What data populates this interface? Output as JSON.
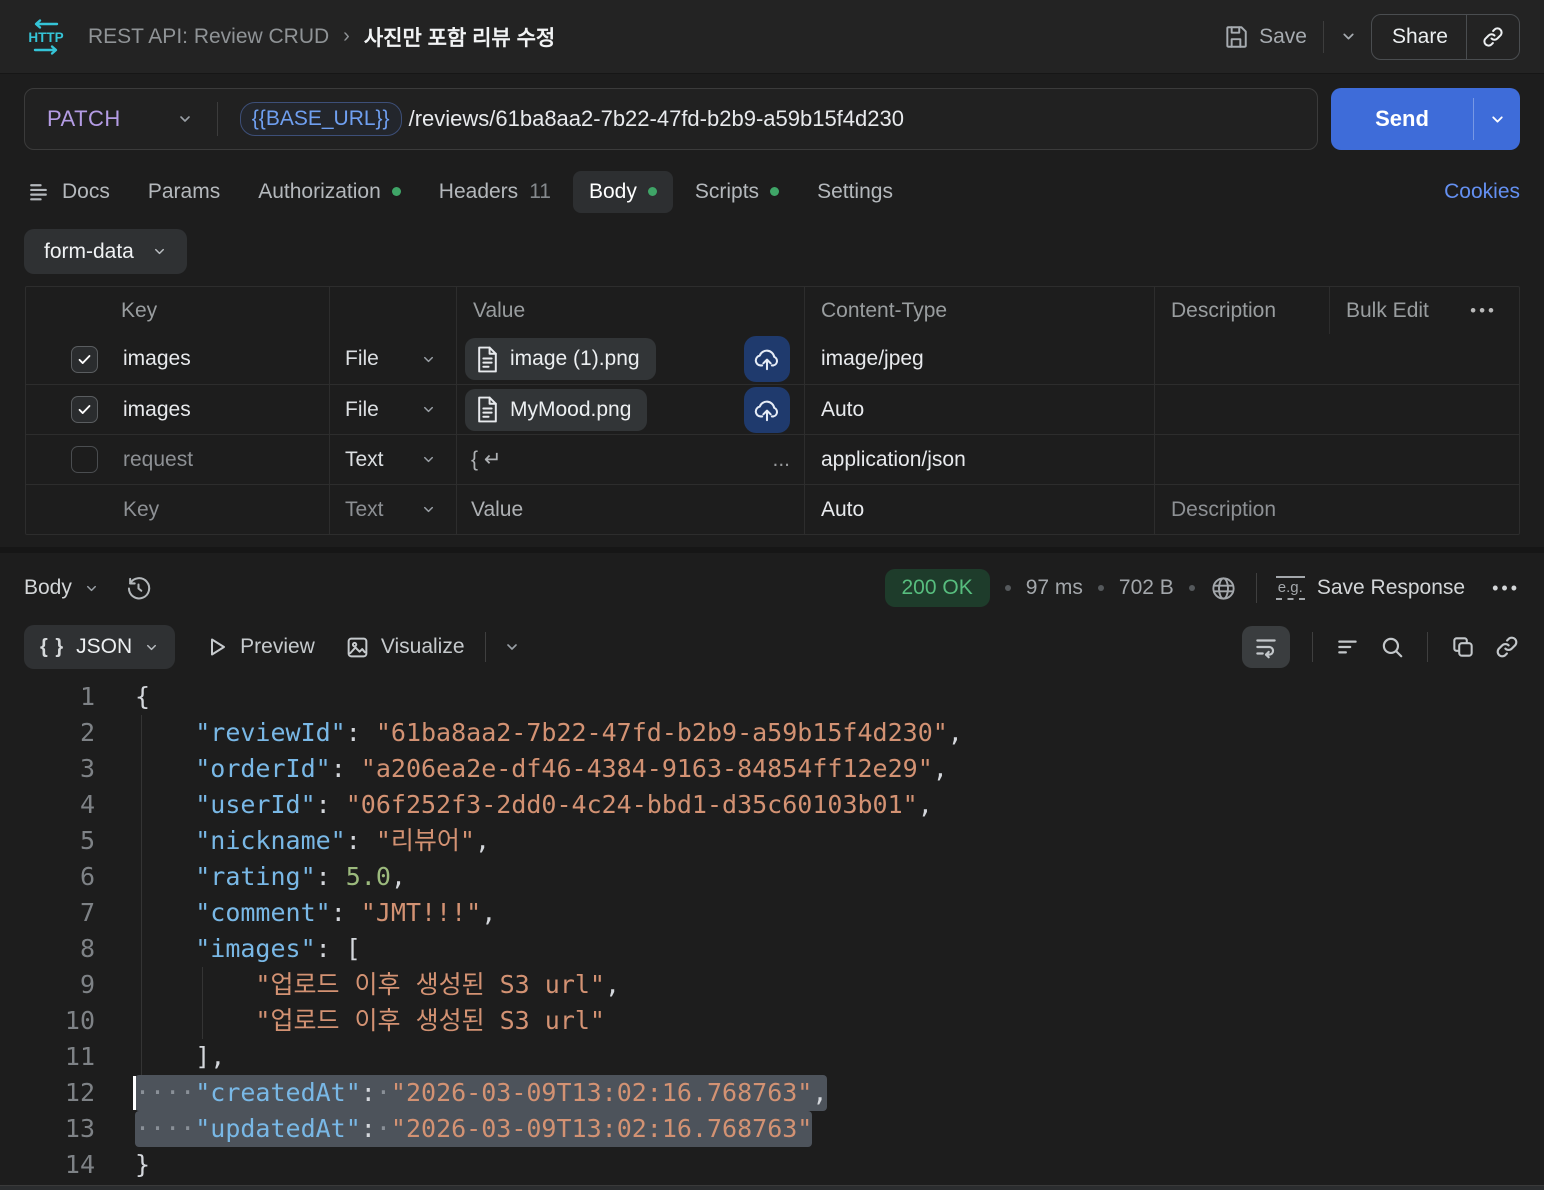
{
  "header": {
    "collection": "REST API: Review CRUD",
    "separator": "›",
    "request_name": "사진만 포함 리뷰 수정",
    "save_label": "Save",
    "share_label": "Share"
  },
  "request": {
    "method": "PATCH",
    "base_url_var": "{{BASE_URL}}",
    "path": "/reviews/61ba8aa2-7b22-47fd-b2b9-a59b15f4d230",
    "send_label": "Send"
  },
  "tabs": [
    {
      "label": "Docs",
      "icon": "docs-icon"
    },
    {
      "label": "Params"
    },
    {
      "label": "Authorization",
      "dot": true
    },
    {
      "label": "Headers",
      "count": "11"
    },
    {
      "label": "Body",
      "dot": true,
      "active": true
    },
    {
      "label": "Scripts",
      "dot": true
    },
    {
      "label": "Settings"
    }
  ],
  "cookies_label": "Cookies",
  "body_type_label": "form-data",
  "form_table": {
    "headers": {
      "key": "Key",
      "value": "Value",
      "content_type": "Content-Type",
      "description": "Description",
      "bulk_edit": "Bulk Edit",
      "more": "•••"
    },
    "rows": [
      {
        "checkbox": "checked",
        "key": "images",
        "key_muted": false,
        "type": "File",
        "type_muted": false,
        "value": {
          "kind": "file",
          "name": "image (1).png"
        },
        "content_type": "image/jpeg",
        "ct_muted": false,
        "description": ""
      },
      {
        "checkbox": "checked",
        "key": "images",
        "key_muted": false,
        "type": "File",
        "type_muted": false,
        "value": {
          "kind": "file",
          "name": "MyMood.png"
        },
        "content_type": "Auto",
        "ct_muted": true,
        "description": ""
      },
      {
        "checkbox": "unchecked",
        "key": "request",
        "key_muted": true,
        "type": "Text",
        "type_muted": false,
        "value": {
          "kind": "inline",
          "text": "{ ↵",
          "more": "..."
        },
        "content_type": "application/json",
        "ct_muted": false,
        "description": ""
      },
      {
        "checkbox": "none",
        "key": "Key",
        "key_muted": true,
        "type": "Text",
        "type_muted": true,
        "value": {
          "kind": "placeholder",
          "text": "Value"
        },
        "content_type": "Auto",
        "ct_muted": true,
        "description": "Description"
      }
    ]
  },
  "response": {
    "body_selector_label": "Body",
    "status": "200 OK",
    "time": "97 ms",
    "size": "702 B",
    "eg_badge": "e.g.",
    "save_response_label": "Save Response",
    "more": "•••",
    "viewer": {
      "braces_icon": "{ }",
      "format_label": "JSON",
      "preview_label": "Preview",
      "visualize_label": "Visualize"
    },
    "code": {
      "lines": [
        {
          "n": "1",
          "tokens": [
            {
              "c": "p",
              "t": "{"
            }
          ]
        },
        {
          "n": "2",
          "tokens": [
            {
              "c": "p",
              "t": "    "
            },
            {
              "c": "k",
              "t": "\"reviewId\""
            },
            {
              "c": "p",
              "t": ": "
            },
            {
              "c": "s",
              "t": "\"61ba8aa2-7b22-47fd-b2b9-a59b15f4d230\""
            },
            {
              "c": "p",
              "t": ","
            }
          ]
        },
        {
          "n": "3",
          "tokens": [
            {
              "c": "p",
              "t": "    "
            },
            {
              "c": "k",
              "t": "\"orderId\""
            },
            {
              "c": "p",
              "t": ": "
            },
            {
              "c": "s",
              "t": "\"a206ea2e-df46-4384-9163-84854ff12e29\""
            },
            {
              "c": "p",
              "t": ","
            }
          ]
        },
        {
          "n": "4",
          "tokens": [
            {
              "c": "p",
              "t": "    "
            },
            {
              "c": "k",
              "t": "\"userId\""
            },
            {
              "c": "p",
              "t": ": "
            },
            {
              "c": "s",
              "t": "\"06f252f3-2dd0-4c24-bbd1-d35c60103b01\""
            },
            {
              "c": "p",
              "t": ","
            }
          ]
        },
        {
          "n": "5",
          "tokens": [
            {
              "c": "p",
              "t": "    "
            },
            {
              "c": "k",
              "t": "\"nickname\""
            },
            {
              "c": "p",
              "t": ": "
            },
            {
              "c": "s",
              "t": "\"리뷰어\""
            },
            {
              "c": "p",
              "t": ","
            }
          ]
        },
        {
          "n": "6",
          "tokens": [
            {
              "c": "p",
              "t": "    "
            },
            {
              "c": "k",
              "t": "\"rating\""
            },
            {
              "c": "p",
              "t": ": "
            },
            {
              "c": "n",
              "t": "5.0"
            },
            {
              "c": "p",
              "t": ","
            }
          ]
        },
        {
          "n": "7",
          "tokens": [
            {
              "c": "p",
              "t": "    "
            },
            {
              "c": "k",
              "t": "\"comment\""
            },
            {
              "c": "p",
              "t": ": "
            },
            {
              "c": "s",
              "t": "\"JMT!!!\""
            },
            {
              "c": "p",
              "t": ","
            }
          ]
        },
        {
          "n": "8",
          "tokens": [
            {
              "c": "p",
              "t": "    "
            },
            {
              "c": "k",
              "t": "\"images\""
            },
            {
              "c": "p",
              "t": ": ["
            }
          ]
        },
        {
          "n": "9",
          "tokens": [
            {
              "c": "p",
              "t": "        "
            },
            {
              "c": "s",
              "t": "\"업로드 이후 생성된 S3 url\""
            },
            {
              "c": "p",
              "t": ","
            }
          ]
        },
        {
          "n": "10",
          "tokens": [
            {
              "c": "p",
              "t": "        "
            },
            {
              "c": "s",
              "t": "\"업로드 이후 생성된 S3 url\""
            }
          ]
        },
        {
          "n": "11",
          "tokens": [
            {
              "c": "p",
              "t": "    "
            },
            {
              "c": "p",
              "t": "],"
            }
          ]
        },
        {
          "n": "12",
          "sel": true,
          "cursor": true,
          "tokens": [
            {
              "c": "w",
              "t": "····"
            },
            {
              "c": "k",
              "t": "\"createdAt\""
            },
            {
              "c": "p",
              "t": ":"
            },
            {
              "c": "w",
              "t": "·"
            },
            {
              "c": "s",
              "t": "\"2026-03-09T13:02:16.768763\""
            },
            {
              "c": "p",
              "t": ","
            }
          ]
        },
        {
          "n": "13",
          "sel": true,
          "tokens": [
            {
              "c": "w",
              "t": "····"
            },
            {
              "c": "k",
              "t": "\"updatedAt\""
            },
            {
              "c": "p",
              "t": ":"
            },
            {
              "c": "w",
              "t": "·"
            },
            {
              "c": "s",
              "t": "\"2026-03-09T13:02:16.768763\""
            }
          ]
        },
        {
          "n": "14",
          "tokens": [
            {
              "c": "p",
              "t": "}"
            }
          ]
        }
      ]
    }
  }
}
